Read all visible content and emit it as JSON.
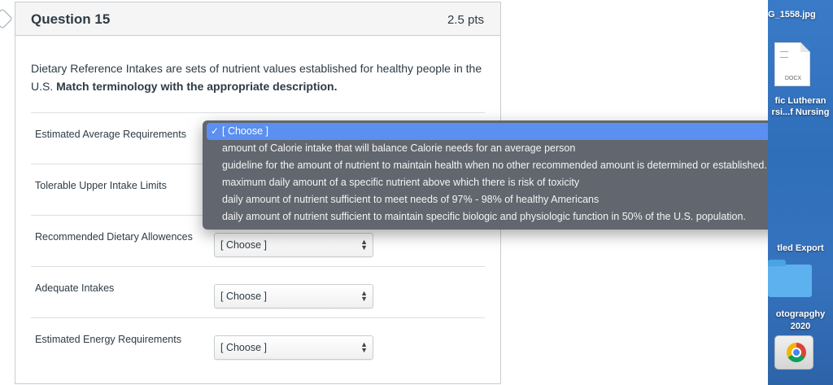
{
  "question": {
    "title": "Question 15",
    "points": "2.5 pts",
    "text_plain": "Dietary Reference Intakes are sets of nutrient values established for healthy people in the U.S. ",
    "text_bold": "Match terminology with the appropriate description."
  },
  "matches": [
    {
      "term": "Estimated Average Requirements",
      "selected": "[ Choose ]"
    },
    {
      "term": "Tolerable Upper Intake Limits",
      "selected": "[ Choose ]"
    },
    {
      "term": "Recommended Dietary Allowences",
      "selected": "[ Choose ]"
    },
    {
      "term": "Adequate Intakes",
      "selected": "[ Choose ]"
    },
    {
      "term": "Estimated Energy Requirements",
      "selected": "[ Choose ]"
    }
  ],
  "dropdown": {
    "options": [
      "[ Choose ]",
      "amount of Calorie intake that will balance Calorie needs for an average person",
      "guideline for the amount of nutrient to maintain health when no other recommended amount is determined or established.",
      "maximum daily amount of a specific nutrient above which there is risk of toxicity",
      "daily amount of nutrient sufficient to meet needs of 97% - 98% of healthy Americans",
      "daily amount of nutrient sufficient to maintain specific biologic and physiologic function in 50% of the U.S. population."
    ],
    "selected_index": 0,
    "check": "✓"
  },
  "desktop": {
    "file1": "G_1558.jpg",
    "doc_type": "DOCX",
    "file2_line1": "fic Lutheran",
    "file2_line2": "rsi...f Nursing",
    "folder1": "tled Export",
    "folder2_line1": "otograpghy",
    "folder2_line2": "2020"
  },
  "colors": {
    "dropdown_bg": "#5c6068",
    "selected_bg": "#5b8ff0",
    "desktop_bg": "#3a7bc8"
  }
}
